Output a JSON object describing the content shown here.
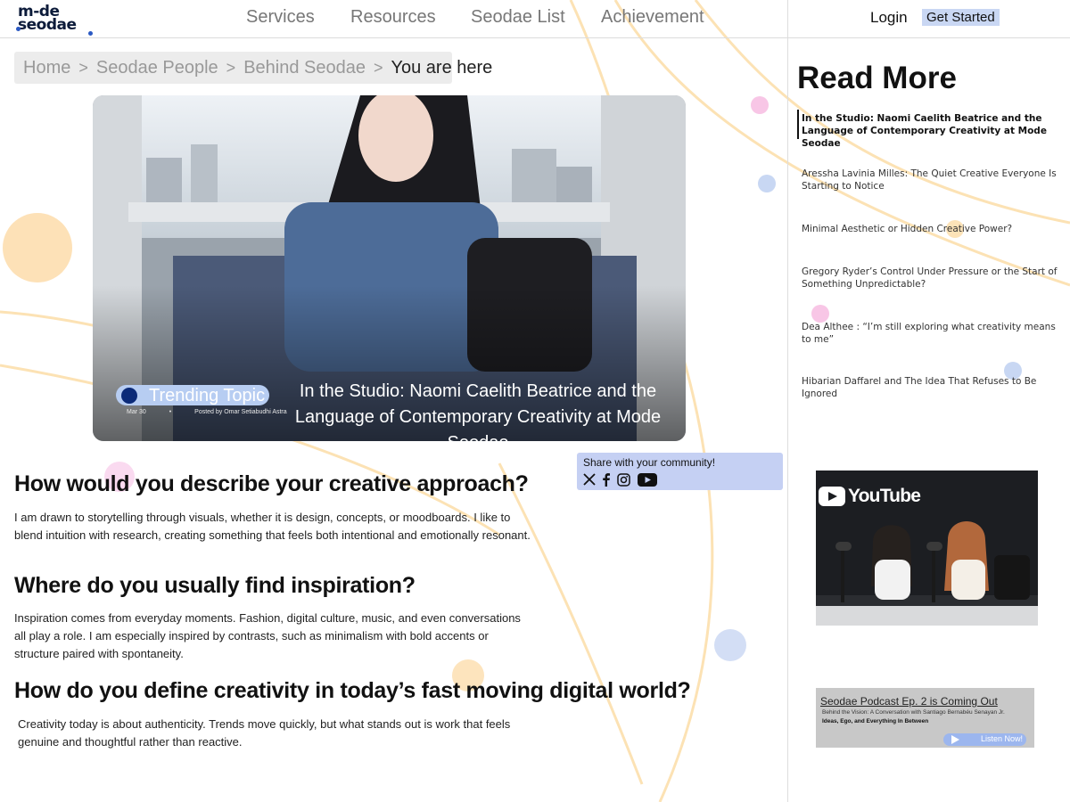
{
  "header": {
    "logo": {
      "line1": "m-de",
      "line2": "seodae"
    },
    "nav": [
      "Services",
      "Resources",
      "Seodae List",
      "Achievement"
    ],
    "login_label": "Login",
    "get_started_label": "Get Started"
  },
  "breadcrumb": {
    "items": [
      "Home",
      "Seodae People",
      "Behind Seodae"
    ],
    "separator": ">",
    "current": "You are here"
  },
  "hero": {
    "badge": "Trending Topic",
    "date": "Mar 30",
    "bullet": "•",
    "posted_by": "Posted by Omar Setiabudhi Astra",
    "title": "In the Studio: Naomi Caelith Beatrice and the Language of Contemporary Creativity at Mode Seodae"
  },
  "share": {
    "label": "Share with your community!",
    "icons": [
      "x-icon",
      "facebook-icon",
      "instagram-icon",
      "youtube-icon"
    ]
  },
  "article": {
    "sections": [
      {
        "question": "How would you describe your creative approach?",
        "answer": "I am drawn to storytelling through visuals, whether it is design, concepts, or moodboards. I like to blend intuition with research, creating something that feels both intentional and emotionally resonant."
      },
      {
        "question": "Where do you usually find inspiration?",
        "answer": "Inspiration comes from everyday moments. Fashion, digital culture, music, and even conversations all play a role. I am especially inspired by contrasts, such as minimalism with bold accents or structure paired with spontaneity."
      },
      {
        "question": "How do you define creativity in today’s fast moving digital world?",
        "answer": "Creativity today is about authenticity. Trends move quickly, but what stands out is work that feels genuine and thoughtful rather than reactive."
      }
    ]
  },
  "read_more": {
    "title": "Read More",
    "items": [
      "In the Studio: Naomi Caelith Beatrice and the Language of Contemporary Creativity at Mode Seodae",
      "Aressha Lavinia Milles: The Quiet Creative Everyone Is Starting to Notice",
      "Minimal Aesthetic or Hidden Creative Power?",
      "Gregory Ryder’s Control Under Pressure or the Start of Something Unpredictable?",
      "Dea Althee : “I’m still exploring what creativity means to me”",
      "Hibarian Daffarel and The Idea That Refuses to Be Ignored"
    ]
  },
  "video": {
    "platform": "YouTube"
  },
  "podcast": {
    "title": "Seodae Podcast Ep. 2 is Coming Out",
    "subtitle": "Behind the Vision: A Conversation with Santiago Bernabéu Senayan Jr.",
    "subtitle2": "Ideas, Ego, and Everything In Between",
    "button": "Listen Now!"
  },
  "colors": {
    "accent_blue": "#c5d0f3",
    "badge_blue": "#b7cdf2",
    "decor_orange": "#fbd9a0",
    "decor_pink": "#f6c6e3",
    "decor_blue": "#c4d3f1"
  }
}
